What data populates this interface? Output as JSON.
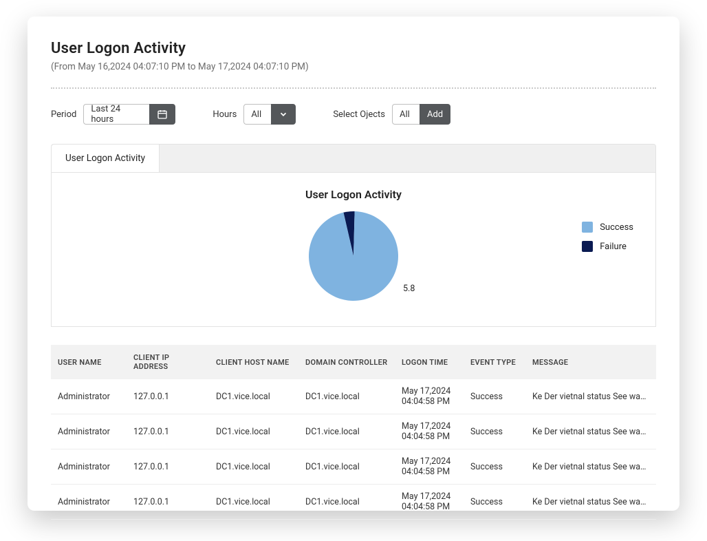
{
  "header": {
    "title": "User Logon Activity",
    "datespan": "(From May 16,2024 04:07:10 PM to May 17,2024 04:07:10 PM)"
  },
  "filters": {
    "period_label": "Period",
    "period_value": "Last 24 hours",
    "hours_label": "Hours",
    "hours_value": "All",
    "objects_label": "Select Ojects",
    "objects_value": "All",
    "add_label": "Add"
  },
  "tab": {
    "label": "User Logon Activity"
  },
  "chart": {
    "title": "User Logon Activity",
    "annotation": "5.8",
    "legend": {
      "success": "Success",
      "failure": "Failure"
    },
    "colors": {
      "success": "#7fb3e0",
      "failure": "#0a1a52"
    }
  },
  "chart_data": {
    "type": "pie",
    "title": "User Logon Activity",
    "series": [
      {
        "name": "Success",
        "value": 96,
        "color": "#7fb3e0"
      },
      {
        "name": "Failure",
        "value": 4,
        "color": "#0a1a52"
      }
    ],
    "annotation": "5.8"
  },
  "table": {
    "headers": {
      "user": "USER NAME",
      "ip": "CLIENT IP ADDRESS",
      "host": "CLIENT HOST NAME",
      "dc": "DOMAIN CONTROLLER",
      "time": "LOGON TIME",
      "event": "EVENT TYPE",
      "message": "MESSAGE"
    },
    "rows": [
      {
        "user": "Administrator",
        "ip": "127.0.0.1",
        "host": "DC1.vice.local",
        "dc": "DC1.vice.local",
        "time_line1": "May 17,2024",
        "time_line2": "04:04:58 PM",
        "event": "Success",
        "message": "Ke Der vietnal status See was..."
      },
      {
        "user": "Administrator",
        "ip": "127.0.0.1",
        "host": "DC1.vice.local",
        "dc": "DC1.vice.local",
        "time_line1": "May 17,2024",
        "time_line2": "04:04:58 PM",
        "event": "Success",
        "message": "Ke Der vietnal status See was..."
      },
      {
        "user": "Administrator",
        "ip": "127.0.0.1",
        "host": "DC1.vice.local",
        "dc": "DC1.vice.local",
        "time_line1": "May 17,2024",
        "time_line2": "04:04:58 PM",
        "event": "Success",
        "message": "Ke Der vietnal status See was..."
      },
      {
        "user": "Administrator",
        "ip": "127.0.0.1",
        "host": "DC1.vice.local",
        "dc": "DC1.vice.local",
        "time_line1": "May 17,2024",
        "time_line2": "04:04:58 PM",
        "event": "Success",
        "message": "Ke Der vietnal status See was..."
      }
    ]
  }
}
